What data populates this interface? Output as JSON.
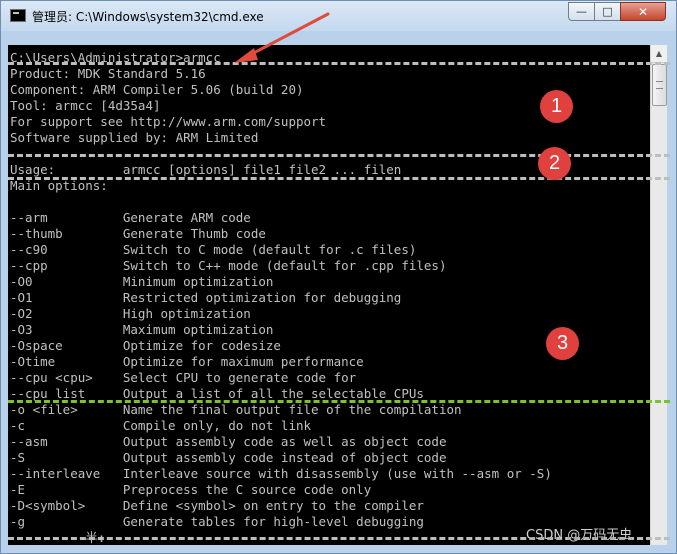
{
  "window": {
    "title": "管理员: C:\\Windows\\system32\\cmd.exe",
    "controls": {
      "minimize": "—",
      "maximize": "□",
      "close": "✕"
    }
  },
  "console": {
    "lines": [
      "C:\\Users\\Administrator>armcc",
      "Product: MDK Standard 5.16",
      "Component: ARM Compiler 5.06 (build 20)",
      "Tool: armcc [4d35a4]",
      "For support see http://www.arm.com/support",
      "Software supplied by: ARM Limited",
      "",
      "Usage:         armcc [options] file1 file2 ... filen",
      "Main options:",
      "",
      "--arm          Generate ARM code",
      "--thumb        Generate Thumb code",
      "--c90          Switch to C mode (default for .c files)",
      "--cpp          Switch to C++ mode (default for .cpp files)",
      "-O0            Minimum optimization",
      "-O1            Restricted optimization for debugging",
      "-O2            High optimization",
      "-O3            Maximum optimization",
      "-Ospace        Optimize for codesize",
      "-Otime         Optimize for maximum performance",
      "--cpu <cpu>    Select CPU to generate code for",
      "--cpu list     Output a list of all the selectable CPUs",
      "-o <file>      Name the final output file of the compilation",
      "-c             Compile only, do not link",
      "--asm          Output assembly code as well as object code",
      "-S             Output assembly code instead of object code",
      "--interleave   Interleave source with disassembly (use with --asm or -S)",
      "-E             Preprocess the C source code only",
      "-D<symbol>     Define <symbol> on entry to the compiler",
      "-g             Generate tables for high-level debugging",
      "          半:"
    ]
  },
  "annotations": {
    "badges": [
      "1",
      "2",
      "3"
    ],
    "arrow_color": "#e04a3c",
    "dash_color": "#bdbdbd",
    "dash_highlight_color": "#7ec12b"
  },
  "watermark": "CSDN @万码无虫"
}
